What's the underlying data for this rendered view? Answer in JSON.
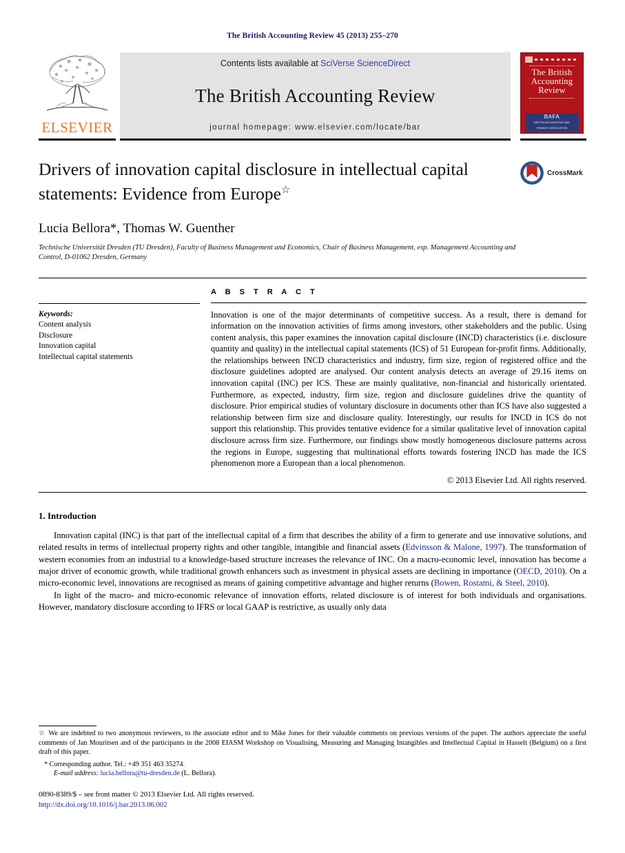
{
  "running_head": "The British Accounting Review 45 (2013) 255–270",
  "masthead": {
    "contents_prefix": "Contents lists available at ",
    "sciverse": "SciVerse",
    "sciencedirect": " ScienceDirect",
    "journal_title": "The British Accounting Review",
    "homepage": "journal homepage: www.elsevier.com/locate/bar",
    "publisher_wordmark": "ELSEVIER",
    "cover": {
      "title": "The British Accounting Review",
      "logo_text": "BAFA",
      "logo_sub": "BRITISH ACCOUNTING AND FINANCE ASSOCIATION"
    }
  },
  "article": {
    "title": "Drivers of innovation capital disclosure in intellectual capital statements: Evidence from Europe",
    "title_footnote_marker": "☆",
    "crossmark_label": "CrossMark",
    "authors": "Lucia Bellora*, Thomas W. Guenther",
    "affiliation": "Technische Universität Dresden (TU Dresden), Faculty of Business Management and Economics, Chair of Business Management, esp. Management Accounting and Control, D-01062 Dresden, Germany"
  },
  "keywords": {
    "heading": "Keywords:",
    "items": [
      "Content analysis",
      "Disclosure",
      "Innovation capital",
      "Intellectual capital statements"
    ]
  },
  "abstract": {
    "heading": "A B S T R A C T",
    "text": "Innovation is one of the major determinants of competitive success. As a result, there is demand for information on the innovation activities of firms among investors, other stakeholders and the public. Using content analysis, this paper examines the innovation capital disclosure (INCD) characteristics (i.e. disclosure quantity and quality) in the intellectual capital statements (ICS) of 51 European for-profit firms. Additionally, the relationships between INCD characteristics and industry, firm size, region of registered office and the disclosure guidelines adopted are analysed. Our content analysis detects an average of 29.16 items on innovation capital (INC) per ICS. These are mainly qualitative, non-financial and historically orientated. Furthermore, as expected, industry, firm size, region and disclosure guidelines drive the quantity of disclosure. Prior empirical studies of voluntary disclosure in documents other than ICS have also suggested a relationship between firm size and disclosure quality. Interestingly, our results for INCD in ICS do not support this relationship. This provides tentative evidence for a similar qualitative level of innovation capital disclosure across firm size. Furthermore, our findings show mostly homogeneous disclosure patterns across the regions in Europe, suggesting that multinational efforts towards fostering INCD has made the ICS phenomenon more a European than a local phenomenon.",
    "copyright": "© 2013 Elsevier Ltd. All rights reserved."
  },
  "introduction": {
    "heading": "1. Introduction",
    "paragraph1_part1": "Innovation capital (INC) is that part of the intellectual capital of a firm that describes the ability of a firm to generate and use innovative solutions, and related results in terms of intellectual property rights and other tangible, intangible and financial assets (",
    "citation1": "Edvinsson & Malone, 1997",
    "paragraph1_part2": "). The transformation of western economies from an industrial to a knowledge-based structure increases the relevance of INC. On a macro-economic level, innovation has become a major driver of economic growth, while traditional growth enhancers such as investment in physical assets are declining in importance (",
    "citation2": "OECD, 2010",
    "paragraph1_part3": "). On a micro-economic level, innovations are recognised as means of gaining competitive advantage and higher returns (",
    "citation3": "Bowen, Rostami, & Steel, 2010",
    "paragraph1_part4": ").",
    "paragraph2": "In light of the macro- and micro-economic relevance of innovation efforts, related disclosure is of interest for both individuals and organisations. However, mandatory disclosure according to IFRS or local GAAP is restrictive, as usually only data"
  },
  "footnotes": {
    "acknowledgement_marker": "☆",
    "acknowledgement": "We are indebted to two anonymous reviewers, to the associate editor and to Mike Jones for their valuable comments on previous versions of the paper. The authors appreciate the useful comments of Jan Mouritsen and of the participants in the 2008 EIASM Workshop on Visualising, Measuring and Managing Intangibles and Intellectual Capital in Hasselt (Belgium) on a first draft of this paper.",
    "corresponding_marker": "*",
    "corresponding": "Corresponding author. Tel.: +49 351 463 35274.",
    "email_label": "E-mail address:",
    "email": "lucia.bellora@tu-dresden.de",
    "email_suffix": " (L. Bellora).",
    "issn_line": "0890-8389/$ – see front matter © 2013 Elsevier Ltd. All rights reserved.",
    "doi": "http://dx.doi.org/10.1016/j.bar.2013.06.002"
  },
  "colors": {
    "running_head": "#151a63",
    "elsevier_orange": "#e87722",
    "link_blue": "#1b2a8c",
    "cover_red": "#b3131b"
  }
}
